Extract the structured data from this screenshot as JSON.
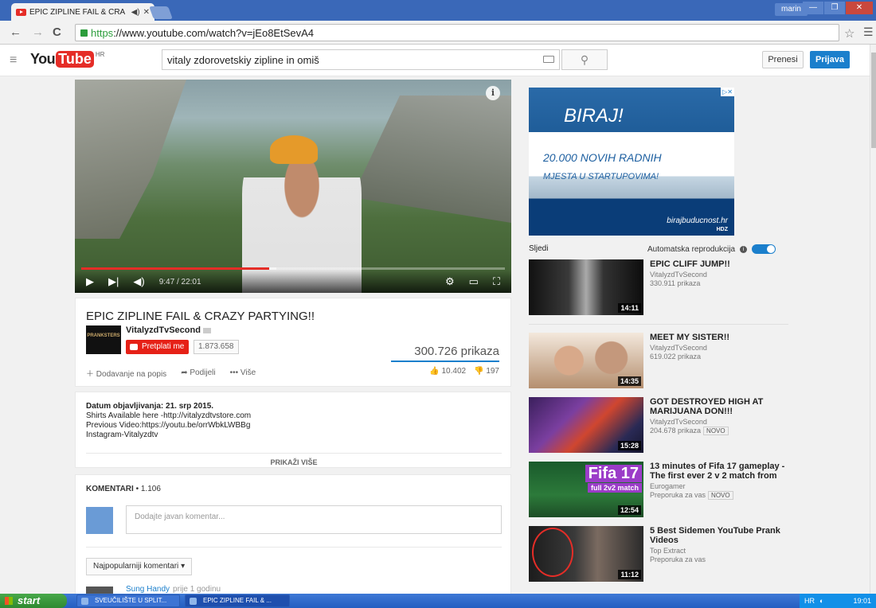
{
  "browser": {
    "tab_title": "EPIC ZIPLINE FAIL & CRA",
    "tab_close": "✕",
    "url_scheme": "https",
    "url_rest": "://www.youtube.com/watch?v=jEo8EtSevA4",
    "user": "marin"
  },
  "youtube": {
    "logo_you": "You",
    "logo_tube": "Tube",
    "logo_country": "HR",
    "search_value": "vitaly zdorovetskiy zipline in omiš",
    "upload_label": "Prenesi",
    "signin_label": "Prijava"
  },
  "player": {
    "time": "9:47 / 22:01",
    "played_fraction": 0.444,
    "loaded_fraction": 0.46
  },
  "video": {
    "title": "EPIC ZIPLINE FAIL & CRAZY PARTYING!!",
    "channel": "VitalyzdTvSecond",
    "channel_logo_text": "PRANKSTERS",
    "subscribe_label": "Pretplati me",
    "subscribers": "1.873.658",
    "views": "300.726 prikaza",
    "action_add": "Dodavanje na popis",
    "action_share": "Podijeli",
    "action_more": "Više",
    "likes": "10.402",
    "dislikes": "197"
  },
  "description": {
    "date": "Datum objavljivanja: 21. srp 2015.",
    "line1": "Shirts Available here -http://vitalyzdtvstore.com",
    "line2": "Previous Video:https://youtu.be/orrWbkLWBBg",
    "line3": "Instagram-Vitalyzdtv",
    "show_more": "PRIKAŽI VIŠE"
  },
  "comments": {
    "header": "KOMENTARI",
    "count": "1.106",
    "placeholder": "Dodajte javan komentar...",
    "sort_label": "Najpopularniji komentari",
    "first_author": "Sung Handy",
    "first_ago": "prije 1 godinu"
  },
  "ad": {
    "headline": "BIRAJ!",
    "line1": "20.000 NOVIH RADNIH",
    "line2": "MJESTA U STARTUPOVIMA!",
    "site": "birajbuducnost.hr",
    "party": "HDZ"
  },
  "sidebar": {
    "next_label": "Sljedi",
    "autoplay_label": "Automatska reprodukcija",
    "items": [
      {
        "title": "EPIC CLIFF JUMP!!",
        "channel": "VitalyzdTvSecond",
        "meta": "330.911 prikaza",
        "badge": "",
        "duration": "14:11"
      },
      {
        "title": "MEET MY SISTER!!",
        "channel": "VitalyzdTvSecond",
        "meta": "619.022 prikaza",
        "badge": "",
        "duration": "14:35"
      },
      {
        "title": "GOT DESTROYED HIGH AT MARIJUANA DON!!!",
        "channel": "VitalyzdTvSecond",
        "meta": "204.678 prikaza",
        "badge": "NOVO",
        "duration": "15:28"
      },
      {
        "title": "13 minutes of Fifa 17 gameplay - The first ever 2 v 2 match from",
        "channel": "Eurogamer",
        "meta": "Preporuka za vas",
        "badge": "NOVO",
        "duration": "12:54",
        "thumb_title": "Fifa 17",
        "thumb_sub": "full 2v2 match"
      },
      {
        "title": "5 Best Sidemen YouTube Prank Videos",
        "channel": "Top Extract",
        "meta": "Preporuka za vas",
        "badge": "",
        "duration": "11:12"
      }
    ]
  },
  "taskbar": {
    "start": "start",
    "task1": "SVEUČILIŠTE U SPLIT...",
    "task2": "EPIC ZIPLINE FAIL & ...",
    "lang": "HR",
    "clock": "19:01"
  }
}
